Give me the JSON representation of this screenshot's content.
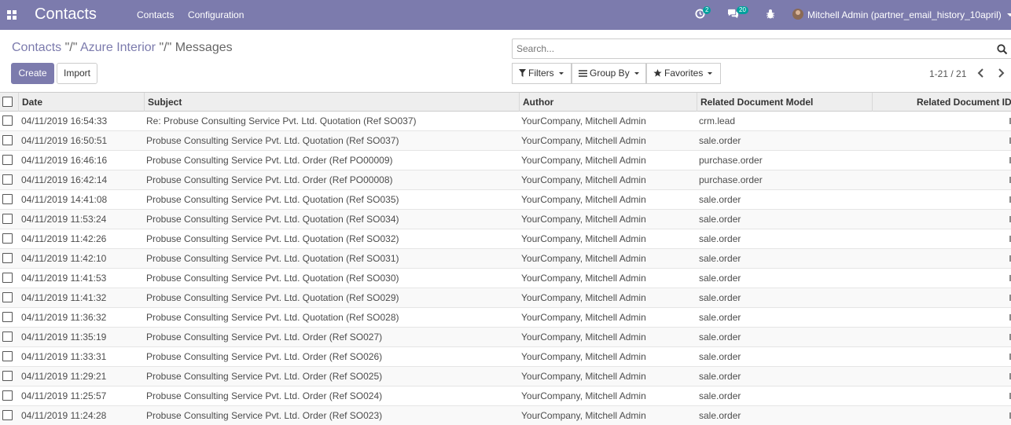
{
  "navbar": {
    "app_title": "Contacts",
    "menu": [
      "Contacts",
      "Configuration"
    ],
    "activity_count": "2",
    "messages_count": "20",
    "user": "Mitchell Admin (partner_email_history_10april)"
  },
  "breadcrumb": {
    "part1": "Contacts",
    "sep1": " \"/\" ",
    "part2": "Azure Interior",
    "sep2": " \"/\" ",
    "current": "Messages"
  },
  "buttons": {
    "create": "Create",
    "import": "Import"
  },
  "search": {
    "placeholder": "Search..."
  },
  "filters": {
    "filters": "Filters",
    "group_by": "Group By",
    "favorites": "Favorites"
  },
  "pager": {
    "value": "1-21 / 21"
  },
  "table": {
    "columns": [
      "Date",
      "Subject",
      "Author",
      "Related Document Model",
      "Related Document ID"
    ],
    "rows": [
      {
        "date": "04/11/2019 16:54:33",
        "subject": "Re: Probuse Consulting Service Pvt. Ltd. Quotation (Ref SO037)",
        "author": "YourCompany, Mitchell Admin",
        "model": "crm.lead"
      },
      {
        "date": "04/11/2019 16:50:51",
        "subject": "Probuse Consulting Service Pvt. Ltd. Quotation (Ref SO037)",
        "author": "YourCompany, Mitchell Admin",
        "model": "sale.order"
      },
      {
        "date": "04/11/2019 16:46:16",
        "subject": "Probuse Consulting Service Pvt. Ltd. Order (Ref PO00009)",
        "author": "YourCompany, Mitchell Admin",
        "model": "purchase.order"
      },
      {
        "date": "04/11/2019 16:42:14",
        "subject": "Probuse Consulting Service Pvt. Ltd. Order (Ref PO00008)",
        "author": "YourCompany, Mitchell Admin",
        "model": "purchase.order"
      },
      {
        "date": "04/11/2019 14:41:08",
        "subject": "Probuse Consulting Service Pvt. Ltd. Quotation (Ref SO035)",
        "author": "YourCompany, Mitchell Admin",
        "model": "sale.order"
      },
      {
        "date": "04/11/2019 11:53:24",
        "subject": "Probuse Consulting Service Pvt. Ltd. Quotation (Ref SO034)",
        "author": "YourCompany, Mitchell Admin",
        "model": "sale.order"
      },
      {
        "date": "04/11/2019 11:42:26",
        "subject": "Probuse Consulting Service Pvt. Ltd. Quotation (Ref SO032)",
        "author": "YourCompany, Mitchell Admin",
        "model": "sale.order"
      },
      {
        "date": "04/11/2019 11:42:10",
        "subject": "Probuse Consulting Service Pvt. Ltd. Quotation (Ref SO031)",
        "author": "YourCompany, Mitchell Admin",
        "model": "sale.order"
      },
      {
        "date": "04/11/2019 11:41:53",
        "subject": "Probuse Consulting Service Pvt. Ltd. Quotation (Ref SO030)",
        "author": "YourCompany, Mitchell Admin",
        "model": "sale.order"
      },
      {
        "date": "04/11/2019 11:41:32",
        "subject": "Probuse Consulting Service Pvt. Ltd. Quotation (Ref SO029)",
        "author": "YourCompany, Mitchell Admin",
        "model": "sale.order"
      },
      {
        "date": "04/11/2019 11:36:32",
        "subject": "Probuse Consulting Service Pvt. Ltd. Quotation (Ref SO028)",
        "author": "YourCompany, Mitchell Admin",
        "model": "sale.order"
      },
      {
        "date": "04/11/2019 11:35:19",
        "subject": "Probuse Consulting Service Pvt. Ltd. Order (Ref SO027)",
        "author": "YourCompany, Mitchell Admin",
        "model": "sale.order"
      },
      {
        "date": "04/11/2019 11:33:31",
        "subject": "Probuse Consulting Service Pvt. Ltd. Order (Ref SO026)",
        "author": "YourCompany, Mitchell Admin",
        "model": "sale.order"
      },
      {
        "date": "04/11/2019 11:29:21",
        "subject": "Probuse Consulting Service Pvt. Ltd. Order (Ref SO025)",
        "author": "YourCompany, Mitchell Admin",
        "model": "sale.order"
      },
      {
        "date": "04/11/2019 11:25:57",
        "subject": "Probuse Consulting Service Pvt. Ltd. Order (Ref SO024)",
        "author": "YourCompany, Mitchell Admin",
        "model": "sale.order"
      },
      {
        "date": "04/11/2019 11:24:28",
        "subject": "Probuse Consulting Service Pvt. Ltd. Order (Ref SO023)",
        "author": "YourCompany, Mitchell Admin",
        "model": "sale.order"
      }
    ]
  },
  "colors": {
    "brand": "#7c7bad",
    "badge": "#00a09d"
  },
  "icons": [
    "apps-icon",
    "activity-icon",
    "messages-icon",
    "bug-icon",
    "search-icon",
    "filter-icon",
    "group-by-icon",
    "favorites-star-icon",
    "chevron-left-icon",
    "chevron-right-icon"
  ]
}
